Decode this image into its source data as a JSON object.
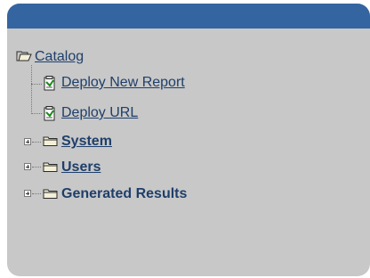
{
  "tree": {
    "root": {
      "label": "Catalog",
      "icon": "open-folder-icon"
    },
    "children": [
      {
        "label": "Deploy New Report",
        "icon": "report-document-icon",
        "bold": false,
        "expandable": false
      },
      {
        "label": "Deploy URL",
        "icon": "report-document-icon",
        "bold": false,
        "expandable": false
      },
      {
        "label": "System",
        "icon": "closed-folder-icon",
        "bold": true,
        "expandable": true
      },
      {
        "label": "Users",
        "icon": "closed-folder-icon",
        "bold": true,
        "expandable": true
      },
      {
        "label": "Generated Results",
        "icon": "closed-folder-icon",
        "bold": true,
        "expandable": true
      }
    ]
  },
  "colors": {
    "header": "#3565a0",
    "panel": "#c8c8c8",
    "link": "#1f3f6a"
  }
}
